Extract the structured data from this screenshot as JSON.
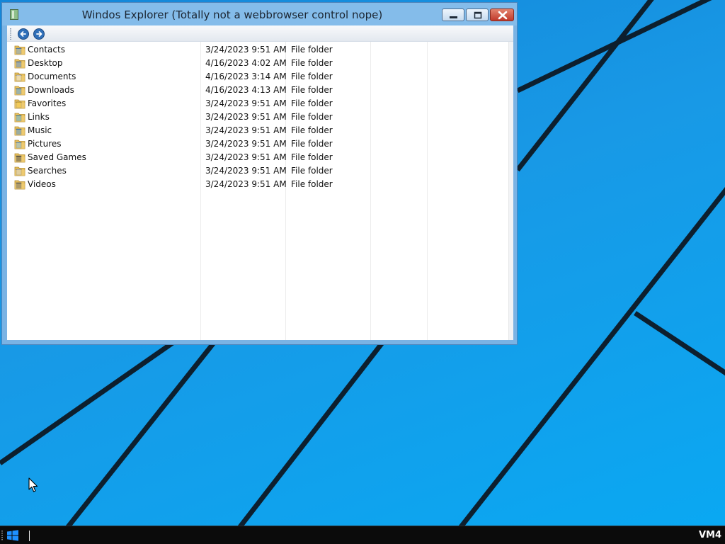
{
  "window": {
    "title": "Windos Explorer (Totally not a webbrowser control nope)"
  },
  "toolbar": {
    "back_icon": "back-arrow-icon",
    "forward_icon": "forward-arrow-icon"
  },
  "file_list": {
    "rows": [
      {
        "name": "Contacts",
        "modified": "3/24/2023 9:51 AM",
        "type": "File folder",
        "icon": "contacts-folder-icon"
      },
      {
        "name": "Desktop",
        "modified": "4/16/2023 4:02 AM",
        "type": "File folder",
        "icon": "desktop-folder-icon"
      },
      {
        "name": "Documents",
        "modified": "4/16/2023 3:14 AM",
        "type": "File folder",
        "icon": "documents-folder-icon"
      },
      {
        "name": "Downloads",
        "modified": "4/16/2023 4:13 AM",
        "type": "File folder",
        "icon": "downloads-folder-icon"
      },
      {
        "name": "Favorites",
        "modified": "3/24/2023 9:51 AM",
        "type": "File folder",
        "icon": "favorites-folder-icon"
      },
      {
        "name": "Links",
        "modified": "3/24/2023 9:51 AM",
        "type": "File folder",
        "icon": "links-folder-icon"
      },
      {
        "name": "Music",
        "modified": "3/24/2023 9:51 AM",
        "type": "File folder",
        "icon": "music-folder-icon"
      },
      {
        "name": "Pictures",
        "modified": "3/24/2023 9:51 AM",
        "type": "File folder",
        "icon": "pictures-folder-icon"
      },
      {
        "name": "Saved Games",
        "modified": "3/24/2023 9:51 AM",
        "type": "File folder",
        "icon": "saved-games-folder-icon"
      },
      {
        "name": "Searches",
        "modified": "3/24/2023 9:51 AM",
        "type": "File folder",
        "icon": "searches-folder-icon"
      },
      {
        "name": "Videos",
        "modified": "3/24/2023 9:51 AM",
        "type": "File folder",
        "icon": "videos-folder-icon"
      }
    ]
  },
  "taskbar": {
    "tray_label": "VM4",
    "start_icon": "windows-logo-icon"
  },
  "colors": {
    "desktop_blue": "#1899e6",
    "title_bar": "#84bcea",
    "close_button": "#c0392b",
    "taskbar": "#0b0b0b"
  }
}
